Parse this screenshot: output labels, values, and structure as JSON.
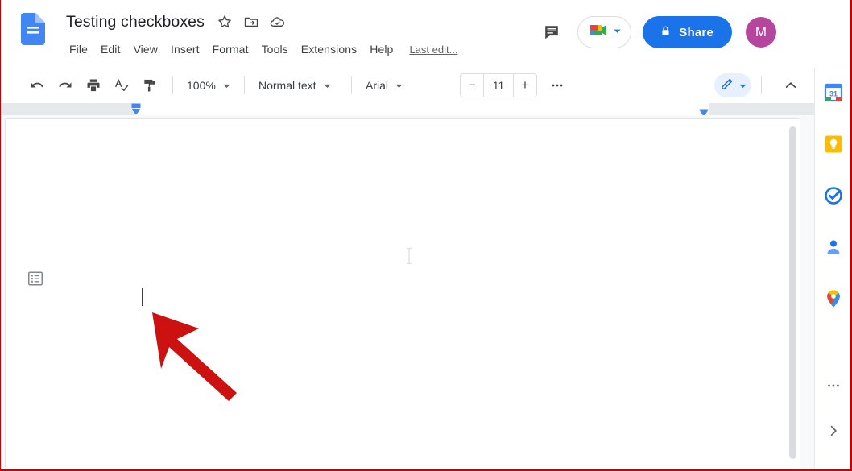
{
  "app": {
    "name": "Google Docs",
    "logo_icon": "docs-file-icon",
    "accent_blue": "#1a73e8",
    "avatar_color": "#b5459d"
  },
  "header": {
    "title": "Testing checkboxes",
    "icons": [
      {
        "name": "star-icon",
        "label": "Star"
      },
      {
        "name": "move-to-folder-icon",
        "label": "Move"
      },
      {
        "name": "cloud-saved-icon",
        "label": "Saved to Drive"
      }
    ],
    "menus": [
      "File",
      "Edit",
      "View",
      "Insert",
      "Format",
      "Tools",
      "Extensions",
      "Help"
    ],
    "last_edit": "Last edit...",
    "comment_icon": "comment-icon",
    "meet_icon": "google-meet-icon",
    "meet_caret": "chevron-down-icon",
    "share_label": "Share",
    "share_icon": "lock-icon",
    "avatar_initial": "M"
  },
  "toolbar": {
    "buttons": [
      {
        "name": "undo-button",
        "label": "Undo"
      },
      {
        "name": "redo-button",
        "label": "Redo"
      },
      {
        "name": "print-button",
        "label": "Print"
      },
      {
        "name": "spelling-check-button",
        "label": "Spelling and grammar check"
      },
      {
        "name": "paint-format-button",
        "label": "Paint format"
      }
    ],
    "zoom_value": "100%",
    "style_value": "Normal text",
    "font_value": "Arial",
    "font_size": "11",
    "decrease_label": "−",
    "increase_label": "+",
    "more_label": "⋯",
    "edit_mode_icon": "pencil-icon",
    "collapse_icon": "chevron-up-icon"
  },
  "ruler": {
    "left_indent_marker": "left-indent-marker",
    "right_indent_marker": "right-indent-marker"
  },
  "document": {
    "outline_icon": "document-outline-icon",
    "body_text": "",
    "caret_visible": true,
    "annotation": {
      "name": "red-arrow-annotation",
      "color": "#cc0000"
    }
  },
  "sidebar": {
    "items": [
      {
        "name": "sidebar-item-calendar",
        "label": "Calendar",
        "badge": "31"
      },
      {
        "name": "sidebar-item-keep",
        "label": "Keep"
      },
      {
        "name": "sidebar-item-tasks",
        "label": "Tasks"
      },
      {
        "name": "sidebar-item-contacts",
        "label": "Contacts"
      },
      {
        "name": "sidebar-item-maps",
        "label": "Maps"
      }
    ],
    "more_label": "⋯",
    "expand_icon": "chevron-right-icon"
  }
}
